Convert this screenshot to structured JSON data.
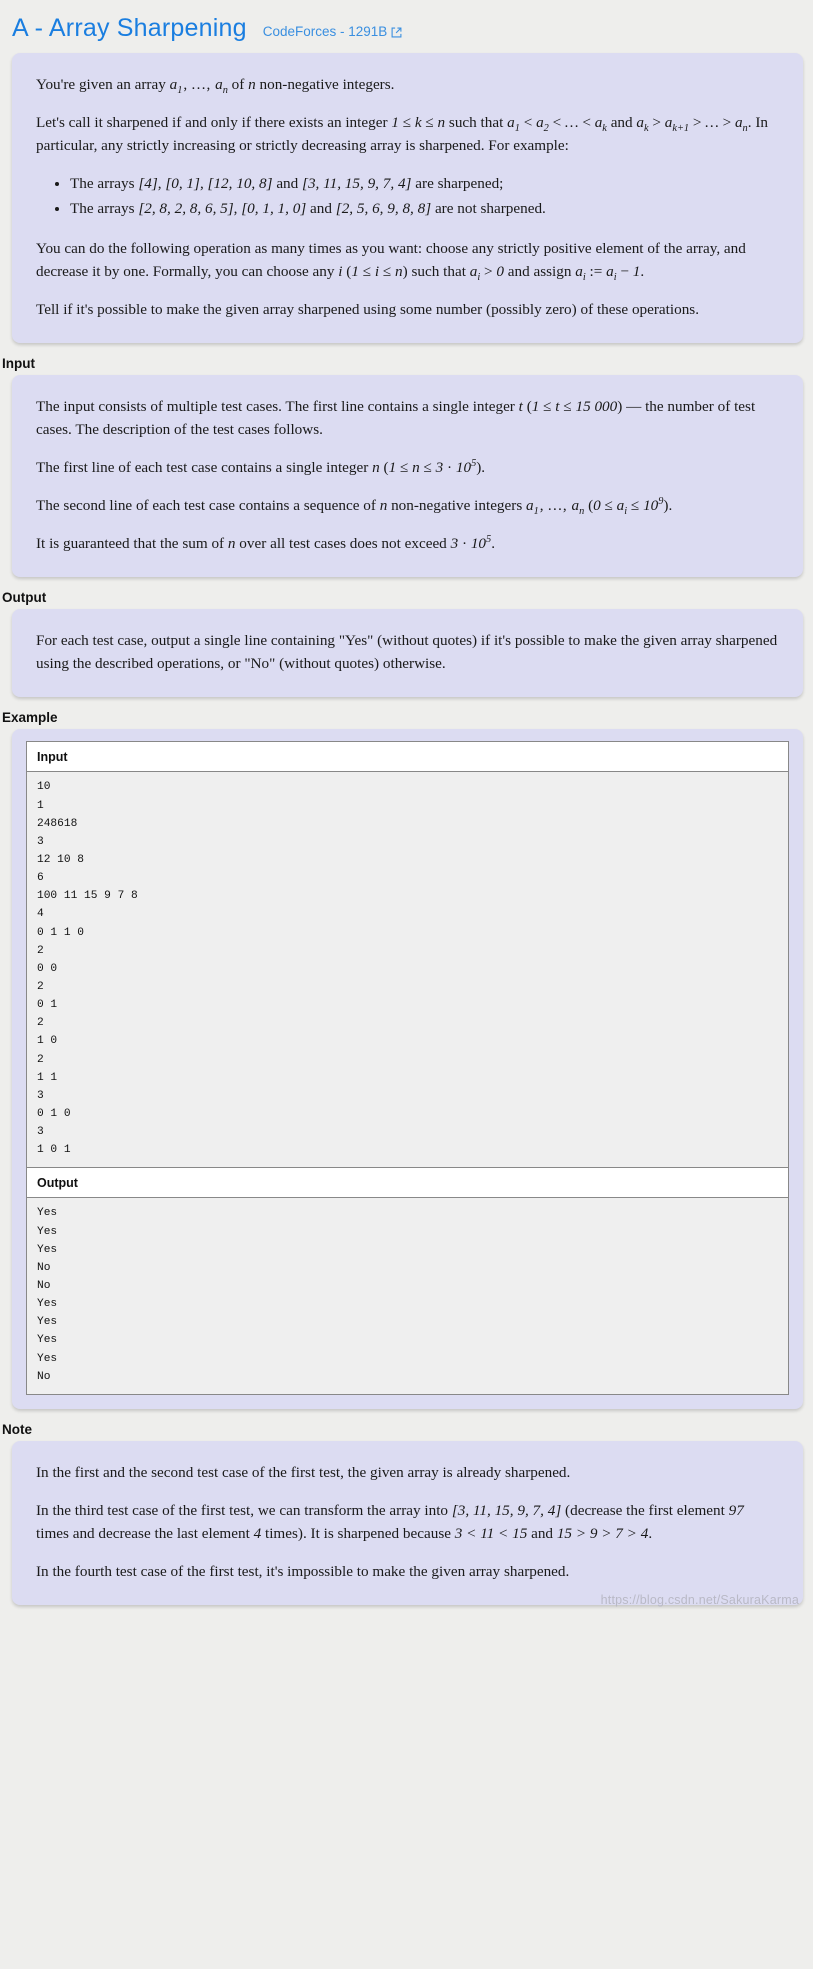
{
  "header": {
    "title": "A - Array Sharpening",
    "source_label": "CodeForces - 1291B",
    "external_icon": "external-link-icon"
  },
  "statement": {
    "p1_a": "You're given an array ",
    "p1_b": " of ",
    "p1_c": " non-negative integers.",
    "p2_a": "Let's call it sharpened if and only if there exists an integer ",
    "p2_b": " such that ",
    "p2_c": " and ",
    "p2_d": ". In particular, any strictly increasing or strictly decreasing array is sharpened. For example:",
    "bullet1_a": "The arrays ",
    "bullet1_b": " are sharpened;",
    "bullet2_a": "The arrays ",
    "bullet2_b": " are not sharpened.",
    "p3_a": "You can do the following operation as many times as you want: choose any strictly positive element of the array, and decrease it by one. Formally, you can choose any ",
    "p3_b": " such that ",
    "p3_c": " and assign ",
    "p3_d": ".",
    "p4": "Tell if it's possible to make the given array sharpened using some number (possibly zero) of these operations.",
    "arrays_sharpened": [
      "[4]",
      "[0, 1]",
      "[12, 10, 8]",
      "[3, 11, 15, 9, 7, 4]"
    ],
    "arrays_not_sharpened": [
      "[2, 8, 2, 8, 6, 5]",
      "[0, 1, 1, 0]",
      "[2, 5, 6, 9, 8, 8]"
    ]
  },
  "input_section": {
    "heading": "Input",
    "p1_a": "The input consists of multiple test cases. The first line contains a single integer ",
    "p1_b": " — the number of test cases. The description of the test cases follows.",
    "p1_constraint": "(1 ≤ t ≤ 15 000)",
    "p2_a": "The first line of each test case contains a single integer ",
    "p2_b": ".",
    "p3_a": "The second line of each test case contains a sequence of ",
    "p3_b": " non-negative integers ",
    "p3_c": " (",
    "p3_d": ").",
    "p4_a": "It is guaranteed that the sum of ",
    "p4_b": " over all test cases does not exceed ",
    "p4_c": "."
  },
  "output_section": {
    "heading": "Output",
    "p1": "For each test case, output a single line containing \"Yes\" (without quotes) if it's possible to make the given array sharpened using the described operations, or \"No\" (without quotes) otherwise."
  },
  "example_section": {
    "heading": "Example",
    "input_label": "Input",
    "output_label": "Output",
    "input_text": "10\n1\n248618\n3\n12 10 8\n6\n100 11 15 9 7 8\n4\n0 1 1 0\n2\n0 0\n2\n0 1\n2\n1 0\n2\n1 1\n3\n0 1 0\n3\n1 0 1",
    "output_text": "Yes\nYes\nYes\nNo\nNo\nYes\nYes\nYes\nYes\nNo"
  },
  "note_section": {
    "heading": "Note",
    "p1": "In the first and the second test case of the first test, the given array is already sharpened.",
    "p2_a": "In the third test case of the first test, we can transform the array into ",
    "p2_b": " (decrease the first element ",
    "p2_c": " times and decrease the last element ",
    "p2_d": " times). It is sharpened because ",
    "p2_e": " and ",
    "p2_f": ".",
    "p2_array": "[3, 11, 15, 9, 7, 4]",
    "p2_n1": "97",
    "p2_n2": "4",
    "p2_ineq1": "3 < 11 < 15",
    "p2_ineq2": "15 > 9 > 7 > 4",
    "p3": "In the fourth test case of the first test, it's impossible to make the given array sharpened."
  },
  "watermark": {
    "text": "https://blog.csdn.net/SakuraKarma"
  },
  "colors": {
    "title_blue": "#1a7ee0",
    "link_blue": "#3a8fe0",
    "card_bg": "#dcdcf2",
    "page_bg": "#eeeeec"
  }
}
